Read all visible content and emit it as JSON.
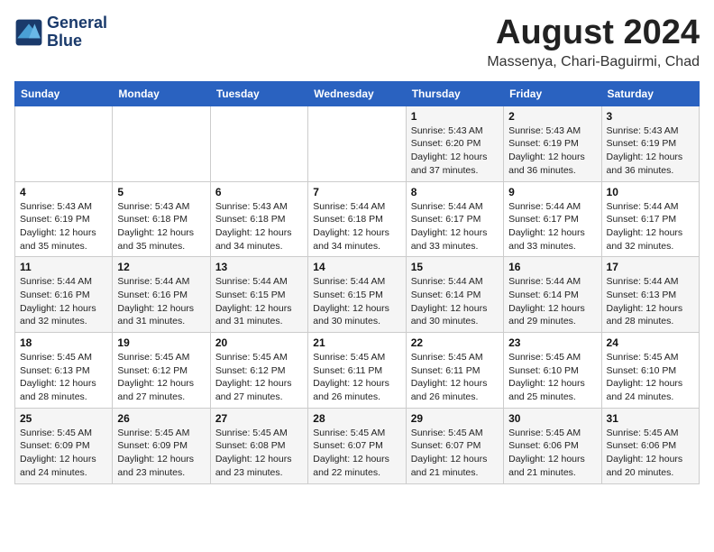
{
  "logo": {
    "line1": "General",
    "line2": "Blue"
  },
  "title": "August 2024",
  "location": "Massenya, Chari-Baguirmi, Chad",
  "days_of_week": [
    "Sunday",
    "Monday",
    "Tuesday",
    "Wednesday",
    "Thursday",
    "Friday",
    "Saturday"
  ],
  "weeks": [
    [
      {
        "day": "",
        "detail": ""
      },
      {
        "day": "",
        "detail": ""
      },
      {
        "day": "",
        "detail": ""
      },
      {
        "day": "",
        "detail": ""
      },
      {
        "day": "1",
        "detail": "Sunrise: 5:43 AM\nSunset: 6:20 PM\nDaylight: 12 hours\nand 37 minutes."
      },
      {
        "day": "2",
        "detail": "Sunrise: 5:43 AM\nSunset: 6:19 PM\nDaylight: 12 hours\nand 36 minutes."
      },
      {
        "day": "3",
        "detail": "Sunrise: 5:43 AM\nSunset: 6:19 PM\nDaylight: 12 hours\nand 36 minutes."
      }
    ],
    [
      {
        "day": "4",
        "detail": "Sunrise: 5:43 AM\nSunset: 6:19 PM\nDaylight: 12 hours\nand 35 minutes."
      },
      {
        "day": "5",
        "detail": "Sunrise: 5:43 AM\nSunset: 6:18 PM\nDaylight: 12 hours\nand 35 minutes."
      },
      {
        "day": "6",
        "detail": "Sunrise: 5:43 AM\nSunset: 6:18 PM\nDaylight: 12 hours\nand 34 minutes."
      },
      {
        "day": "7",
        "detail": "Sunrise: 5:44 AM\nSunset: 6:18 PM\nDaylight: 12 hours\nand 34 minutes."
      },
      {
        "day": "8",
        "detail": "Sunrise: 5:44 AM\nSunset: 6:17 PM\nDaylight: 12 hours\nand 33 minutes."
      },
      {
        "day": "9",
        "detail": "Sunrise: 5:44 AM\nSunset: 6:17 PM\nDaylight: 12 hours\nand 33 minutes."
      },
      {
        "day": "10",
        "detail": "Sunrise: 5:44 AM\nSunset: 6:17 PM\nDaylight: 12 hours\nand 32 minutes."
      }
    ],
    [
      {
        "day": "11",
        "detail": "Sunrise: 5:44 AM\nSunset: 6:16 PM\nDaylight: 12 hours\nand 32 minutes."
      },
      {
        "day": "12",
        "detail": "Sunrise: 5:44 AM\nSunset: 6:16 PM\nDaylight: 12 hours\nand 31 minutes."
      },
      {
        "day": "13",
        "detail": "Sunrise: 5:44 AM\nSunset: 6:15 PM\nDaylight: 12 hours\nand 31 minutes."
      },
      {
        "day": "14",
        "detail": "Sunrise: 5:44 AM\nSunset: 6:15 PM\nDaylight: 12 hours\nand 30 minutes."
      },
      {
        "day": "15",
        "detail": "Sunrise: 5:44 AM\nSunset: 6:14 PM\nDaylight: 12 hours\nand 30 minutes."
      },
      {
        "day": "16",
        "detail": "Sunrise: 5:44 AM\nSunset: 6:14 PM\nDaylight: 12 hours\nand 29 minutes."
      },
      {
        "day": "17",
        "detail": "Sunrise: 5:44 AM\nSunset: 6:13 PM\nDaylight: 12 hours\nand 28 minutes."
      }
    ],
    [
      {
        "day": "18",
        "detail": "Sunrise: 5:45 AM\nSunset: 6:13 PM\nDaylight: 12 hours\nand 28 minutes."
      },
      {
        "day": "19",
        "detail": "Sunrise: 5:45 AM\nSunset: 6:12 PM\nDaylight: 12 hours\nand 27 minutes."
      },
      {
        "day": "20",
        "detail": "Sunrise: 5:45 AM\nSunset: 6:12 PM\nDaylight: 12 hours\nand 27 minutes."
      },
      {
        "day": "21",
        "detail": "Sunrise: 5:45 AM\nSunset: 6:11 PM\nDaylight: 12 hours\nand 26 minutes."
      },
      {
        "day": "22",
        "detail": "Sunrise: 5:45 AM\nSunset: 6:11 PM\nDaylight: 12 hours\nand 26 minutes."
      },
      {
        "day": "23",
        "detail": "Sunrise: 5:45 AM\nSunset: 6:10 PM\nDaylight: 12 hours\nand 25 minutes."
      },
      {
        "day": "24",
        "detail": "Sunrise: 5:45 AM\nSunset: 6:10 PM\nDaylight: 12 hours\nand 24 minutes."
      }
    ],
    [
      {
        "day": "25",
        "detail": "Sunrise: 5:45 AM\nSunset: 6:09 PM\nDaylight: 12 hours\nand 24 minutes."
      },
      {
        "day": "26",
        "detail": "Sunrise: 5:45 AM\nSunset: 6:09 PM\nDaylight: 12 hours\nand 23 minutes."
      },
      {
        "day": "27",
        "detail": "Sunrise: 5:45 AM\nSunset: 6:08 PM\nDaylight: 12 hours\nand 23 minutes."
      },
      {
        "day": "28",
        "detail": "Sunrise: 5:45 AM\nSunset: 6:07 PM\nDaylight: 12 hours\nand 22 minutes."
      },
      {
        "day": "29",
        "detail": "Sunrise: 5:45 AM\nSunset: 6:07 PM\nDaylight: 12 hours\nand 21 minutes."
      },
      {
        "day": "30",
        "detail": "Sunrise: 5:45 AM\nSunset: 6:06 PM\nDaylight: 12 hours\nand 21 minutes."
      },
      {
        "day": "31",
        "detail": "Sunrise: 5:45 AM\nSunset: 6:06 PM\nDaylight: 12 hours\nand 20 minutes."
      }
    ]
  ]
}
